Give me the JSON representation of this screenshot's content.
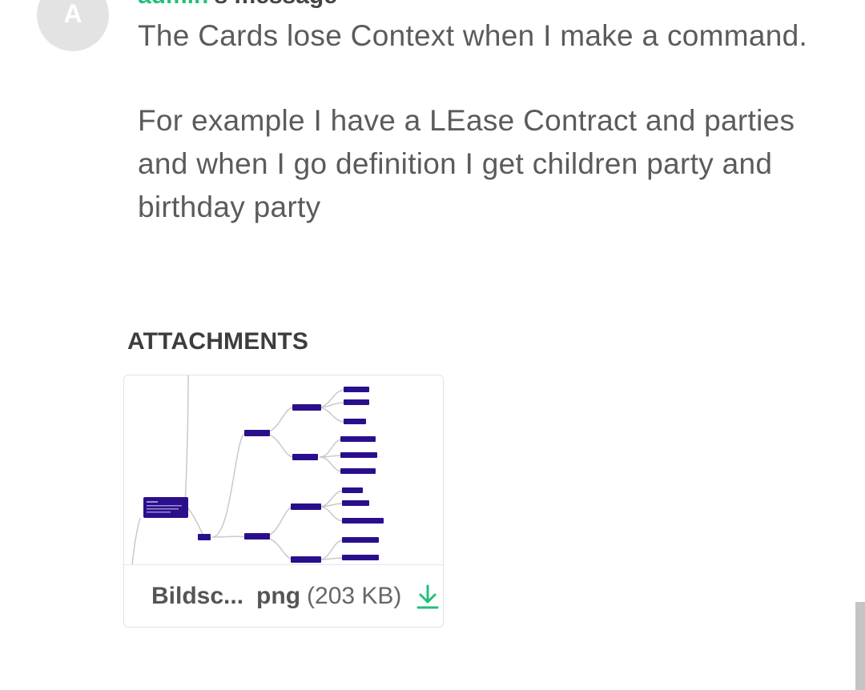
{
  "avatar": {
    "initial": "A"
  },
  "header": {
    "author": "admin",
    "suffix": "'s message"
  },
  "message": {
    "paragraphs": [
      "The Cards lose Context when I make a command.",
      "For example I have a LEase Contract and parties and when I go definition I get children party and birthday party"
    ]
  },
  "attachments": {
    "label": "ATTACHMENTS",
    "file": {
      "name": "Bildsc...",
      "extension": "png",
      "size": "(203 KB)",
      "download_icon": "download-arrow-icon",
      "icon_color": "#22c07a"
    }
  },
  "colors": {
    "accent": "#22c07a",
    "mindmap_node": "#2a0f8c",
    "avatar_bg": "#e3e3e3"
  }
}
